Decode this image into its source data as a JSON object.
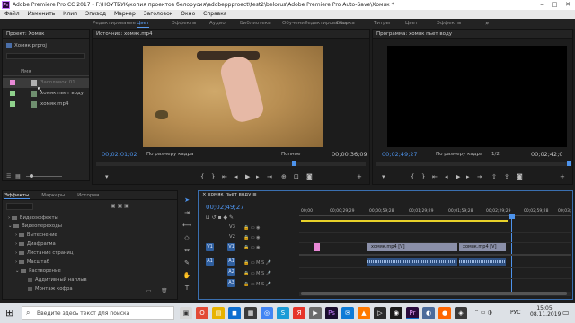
{
  "window": {
    "title": "Adobe Premiere Pro CC 2017 - F:\\НОУТБУК\\копия проектов белорусия\\adobeppproect\\test2\\belorus\\Adobe Premiere Pro Auto-Save\\Хомяк *",
    "app_icon": "Pr"
  },
  "menu": [
    "Файл",
    "Изменить",
    "Клип",
    "Эпизод",
    "Маркер",
    "Заголовок",
    "Окно",
    "Справка"
  ],
  "workspaces": [
    "Редактирование",
    "Цвет",
    "Эффекты",
    "Аудио",
    "Библиотеки",
    "Обучение",
    "Редактирование",
    "Сборка",
    "Титры",
    "Цвет",
    "Эффекты"
  ],
  "project": {
    "title": "Проект: Хомяк",
    "file": "Хомяк.prproj",
    "column": "Имя",
    "items": [
      {
        "name": "Заголовок 01",
        "color": "#e889d6"
      },
      {
        "name": "хомяк пьет воду",
        "color": "#8fd18c"
      },
      {
        "name": "хомяк.mp4",
        "color": "#8fd18c"
      }
    ]
  },
  "source": {
    "title": "Источник: хомяк.mp4",
    "timecode": "00;02;01;02",
    "fit": "По размеру кадра",
    "quality": "Полное",
    "duration": "00;00;36;09"
  },
  "program": {
    "title": "Программа: хомяк пьет воду",
    "timecode": "00;02;49;27",
    "fit": "По размеру кадра",
    "ratio": "1/2",
    "duration": "00;02;42;0"
  },
  "effects": {
    "tabs": [
      "Эффекты",
      "Маркеры",
      "История"
    ],
    "tree": [
      "Видеоэффекты",
      "Видеопереходы",
      "Вытеснение",
      "Диафрагма",
      "Листание страниц",
      "Масштаб",
      "Растворение",
      "Аддитивный наплыв",
      "Монтаж кофра"
    ]
  },
  "timeline": {
    "title": "хомяк пьет воду",
    "timecode": "00;02;49;27",
    "ruler": [
      "00;00",
      "00;00;29;29",
      "00;00;59;28",
      "00;01;29;29",
      "00;01;59;28",
      "00;02;29;29",
      "00;02;59;28",
      "00;03;"
    ],
    "tracks_video": [
      "V3",
      "V2",
      "V1"
    ],
    "tracks_audio": [
      "A1",
      "A2",
      "A3"
    ],
    "source_v": "V1",
    "source_a": "A1",
    "clip1": "хомяк.mp4 [V]",
    "clip2": "хомяк.mp4 [V]"
  },
  "taskbar": {
    "search": "Введите здесь текст для поиска",
    "lang": "РУС",
    "time": "15:05",
    "date": "08.11.2019"
  }
}
